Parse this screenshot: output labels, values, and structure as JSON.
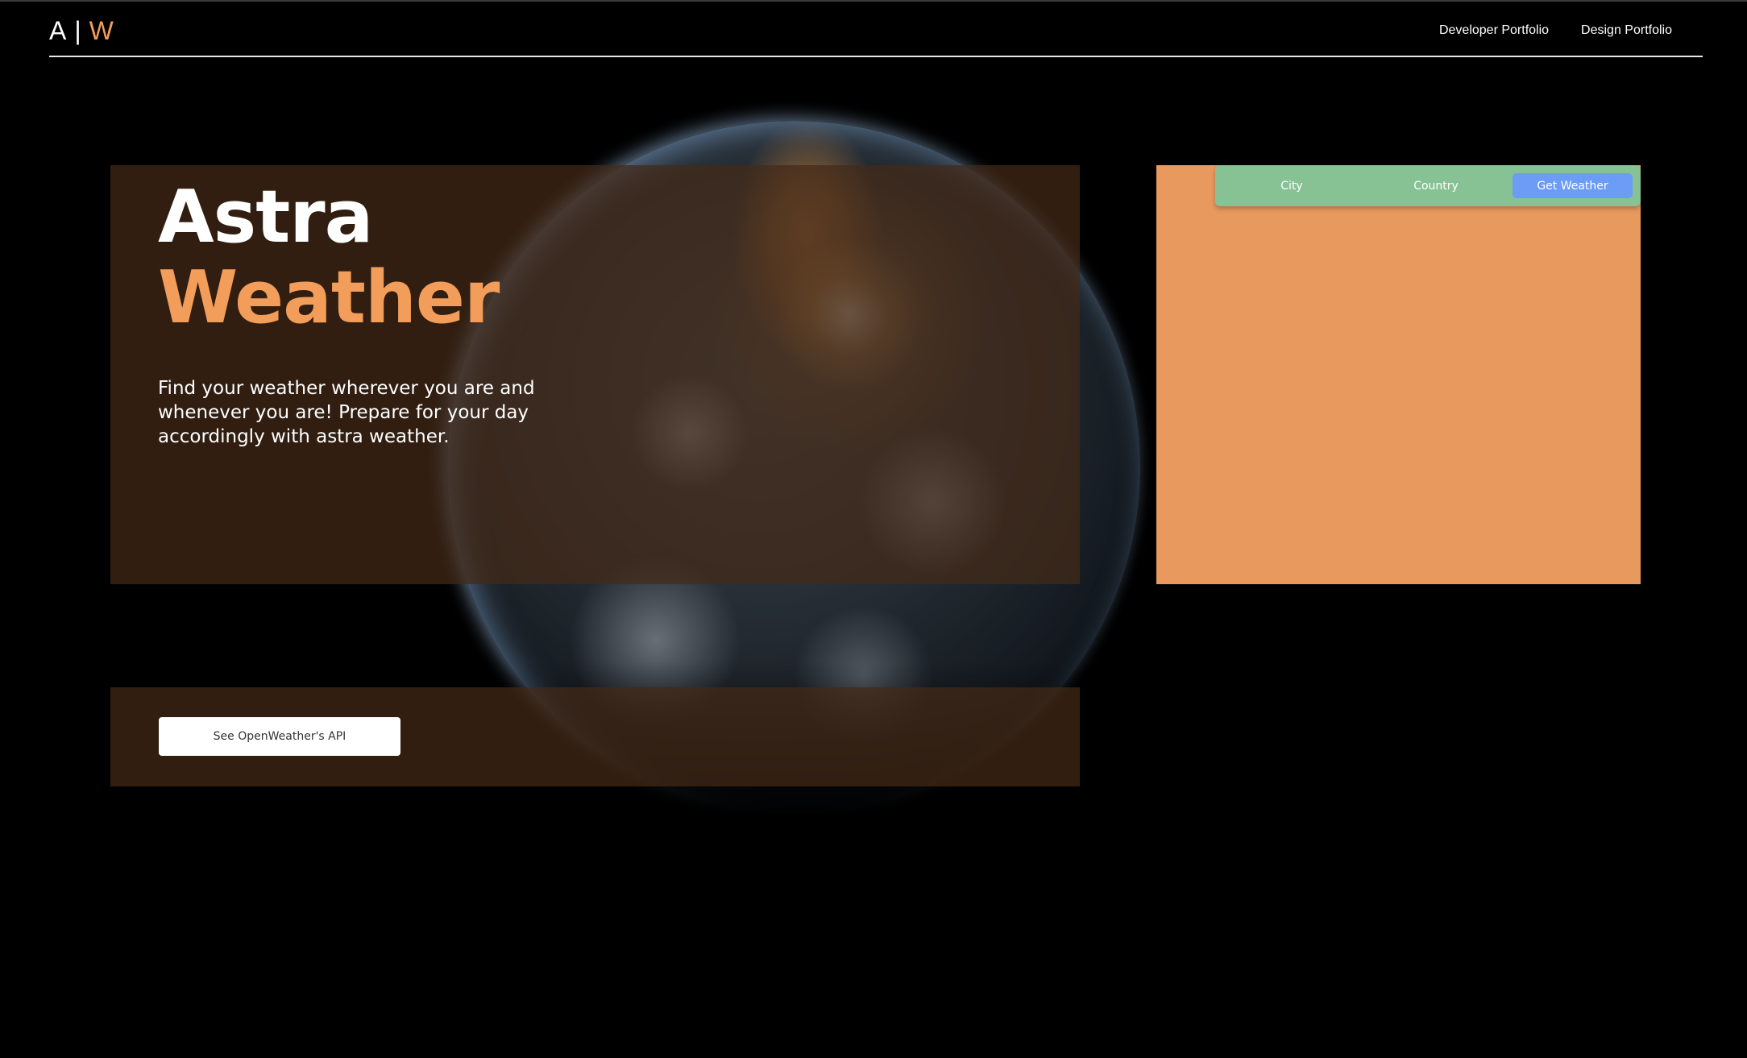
{
  "header": {
    "logo_left": "A",
    "logo_sep": "|",
    "logo_right": "W",
    "nav": [
      {
        "label": "Developer Portfolio"
      },
      {
        "label": "Design Portfolio"
      }
    ]
  },
  "hero": {
    "title_line1": "Astra",
    "title_line2": "Weather",
    "description": "Find your weather wherever you are and whenever you are! Prepare for your day accordingly with astra weather."
  },
  "api_panel": {
    "button_label": "See OpenWeather's API"
  },
  "weather": {
    "city_placeholder": "City",
    "country_placeholder": "Country",
    "button_label": "Get Weather"
  },
  "colors": {
    "background": "#000000",
    "accent_orange": "#f29e5a",
    "panel_brown": "#44291a",
    "weather_panel": "#e8995e",
    "search_bar_green": "#87c294",
    "button_blue": "#6c9cf5"
  },
  "icons": {
    "hero_image": "earth-globe-image"
  }
}
